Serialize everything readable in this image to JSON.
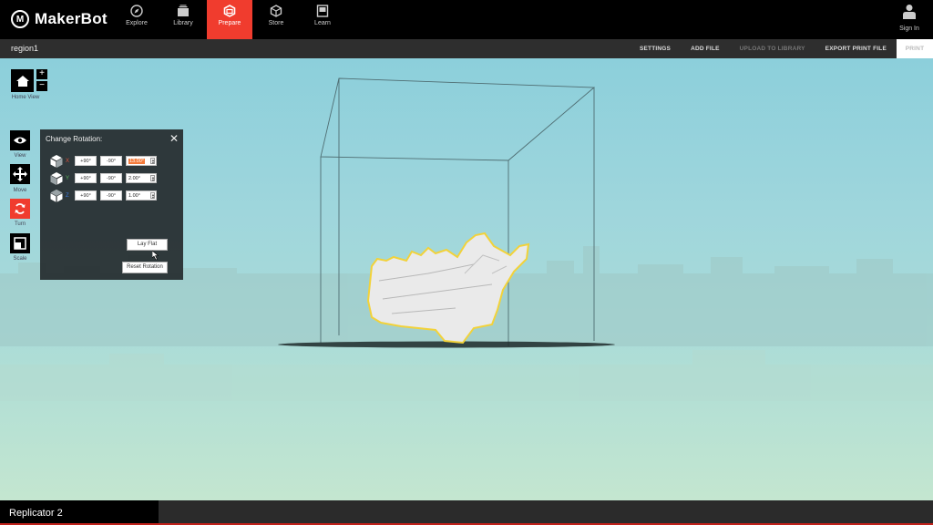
{
  "app": {
    "logo_mark": "M",
    "logo_text": "MakerBot"
  },
  "nav": [
    {
      "label": "Explore",
      "icon": "compass-icon",
      "active": false
    },
    {
      "label": "Library",
      "icon": "library-icon",
      "active": false
    },
    {
      "label": "Prepare",
      "icon": "prepare-cube-icon",
      "active": true
    },
    {
      "label": "Store",
      "icon": "store-cube-icon",
      "active": false
    },
    {
      "label": "Learn",
      "icon": "learn-icon",
      "active": false
    }
  ],
  "account": {
    "label": "Sign In",
    "icon": "user-icon"
  },
  "project": {
    "name": "region1"
  },
  "actions": {
    "settings": "SETTINGS",
    "add_file": "ADD FILE",
    "upload": "UPLOAD TO LIBRARY",
    "export": "EXPORT PRINT FILE",
    "print": "PRINT"
  },
  "tools": {
    "home": "Home View",
    "view": "View",
    "move": "Move",
    "turn": "Turn",
    "scale": "Scale",
    "zoom_in": "+",
    "zoom_out": "−"
  },
  "rotation": {
    "title": "Change Rotation:",
    "close": "✕",
    "rows": [
      {
        "axis": "X",
        "plus": "+90°",
        "minus": "-90°",
        "value": "13.00°",
        "color": "#e0523a"
      },
      {
        "axis": "Y",
        "plus": "+90°",
        "minus": "-90°",
        "value": "2.00°",
        "color": "#5bb85b"
      },
      {
        "axis": "Z",
        "plus": "+90°",
        "minus": "-90°",
        "value": "1.00°",
        "color": "#3a7ae0"
      }
    ],
    "lay_flat": "Lay Flat",
    "reset": "Reset Rotation"
  },
  "printer": {
    "name": "Replicator 2"
  },
  "colors": {
    "accent": "#f03c2e",
    "selection_outline": "#f2d23a"
  }
}
